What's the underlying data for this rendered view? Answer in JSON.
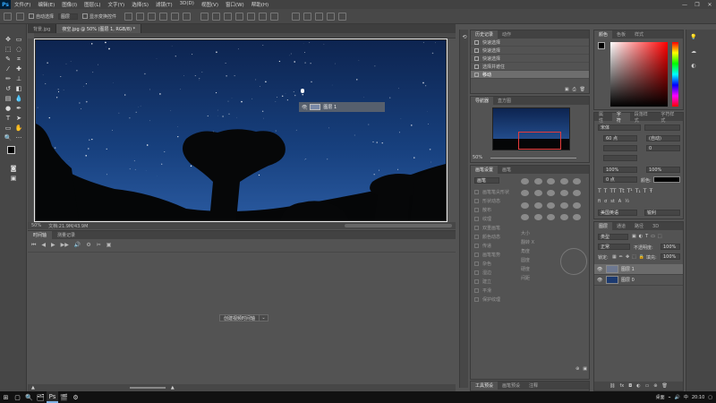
{
  "app": {
    "logo": "Ps",
    "menu": [
      "文件(F)",
      "编辑(E)",
      "图像(I)",
      "图层(L)",
      "文字(Y)",
      "选择(S)",
      "滤镜(T)",
      "3D(D)",
      "视图(V)",
      "窗口(W)",
      "帮助(H)"
    ],
    "window_controls": [
      "—",
      "❐",
      "✕"
    ]
  },
  "options_bar": {
    "auto_select_label": "自动选择",
    "layer_dropdown": "图层",
    "transform_label": "显示变换控件"
  },
  "document": {
    "tabs": [
      {
        "label": "背景.jpg",
        "active": false
      },
      {
        "label": "夜空.jpg @ 50% (图层 1, RGB/8) *",
        "active": true
      }
    ],
    "zoom": "50%",
    "doc_info": "文档:21.9M/43.9M",
    "drag_layer_label": "图层 1"
  },
  "timeline": {
    "tabs": [
      {
        "label": "时间轴",
        "active": true
      },
      {
        "label": "测量记录",
        "active": false
      }
    ],
    "controls": [
      "⏮",
      "◀",
      "▶",
      "▶▶",
      "🔊",
      "⚙",
      "✂",
      "▣"
    ],
    "create_button": "创建视频时间轴"
  },
  "history": {
    "tabs": [
      {
        "label": "历史记录",
        "active": true
      },
      {
        "label": "动作",
        "active": false
      }
    ],
    "items": [
      {
        "label": "快速选择",
        "selected": false
      },
      {
        "label": "快速选择",
        "selected": false
      },
      {
        "label": "快速选择",
        "selected": false
      },
      {
        "label": "选择并遮住",
        "selected": false
      },
      {
        "label": "移动",
        "selected": true
      }
    ]
  },
  "navigator": {
    "tabs": [
      {
        "label": "导航器",
        "active": true
      },
      {
        "label": "直方图",
        "active": false
      }
    ],
    "zoom": "50%"
  },
  "properties": {
    "tabs": [
      {
        "label": "画笔设置",
        "active": true
      },
      {
        "label": "画笔",
        "active": false
      }
    ],
    "brush_button": "画笔",
    "rows": [
      "画笔笔尖形状",
      "形状动态",
      "散布",
      "纹理",
      "双重画笔",
      "颜色动态",
      "传递",
      "画笔笔势",
      "杂色",
      "湿边",
      "建立",
      "平滑",
      "保护纹理"
    ],
    "fields": [
      "大小",
      "翻转 X",
      "角度",
      "圆度",
      "硬度",
      "间距"
    ]
  },
  "tools_panel": {
    "tabs": [
      {
        "label": "工具预设",
        "active": true
      },
      {
        "label": "画笔预设",
        "active": false
      },
      {
        "label": "注释",
        "active": false
      }
    ]
  },
  "color": {
    "tabs": [
      {
        "label": "颜色",
        "active": true
      },
      {
        "label": "色板",
        "active": false
      },
      {
        "label": "样式",
        "active": false
      }
    ],
    "foreground": "#000000",
    "background": "#ffffff"
  },
  "character": {
    "tabs": [
      {
        "label": "属性",
        "active": false
      },
      {
        "label": "字符",
        "active": true
      },
      {
        "label": "段落样式",
        "active": false
      },
      {
        "label": "字符样式",
        "active": false
      }
    ],
    "font": "宋体",
    "size": "60 点",
    "leading": "(自动)",
    "tracking": "0",
    "scale_v": "100%",
    "scale_h": "100%",
    "baseline": "0 点",
    "color_label": "颜色:",
    "language": "美国英语",
    "aa": "锐利"
  },
  "layers": {
    "tabs": [
      {
        "label": "图层",
        "active": true
      },
      {
        "label": "通道",
        "active": false
      },
      {
        "label": "路径",
        "active": false
      },
      {
        "label": "3D",
        "active": false
      }
    ],
    "kind_filter": "类型",
    "blend_mode": "正常",
    "opacity_label": "不透明度:",
    "opacity": "100%",
    "lock_label": "锁定:",
    "fill_label": "填充:",
    "fill": "100%",
    "items": [
      {
        "name": "图层 1",
        "selected": true
      },
      {
        "name": "图层 0",
        "selected": false
      }
    ]
  },
  "taskbar": {
    "start": "⊞",
    "apps": [
      "▢",
      "🔍",
      "🗂",
      "Ps",
      "🎬",
      "⚙"
    ],
    "tray_text": "桌面",
    "lang": "中",
    "time": "20:10"
  }
}
